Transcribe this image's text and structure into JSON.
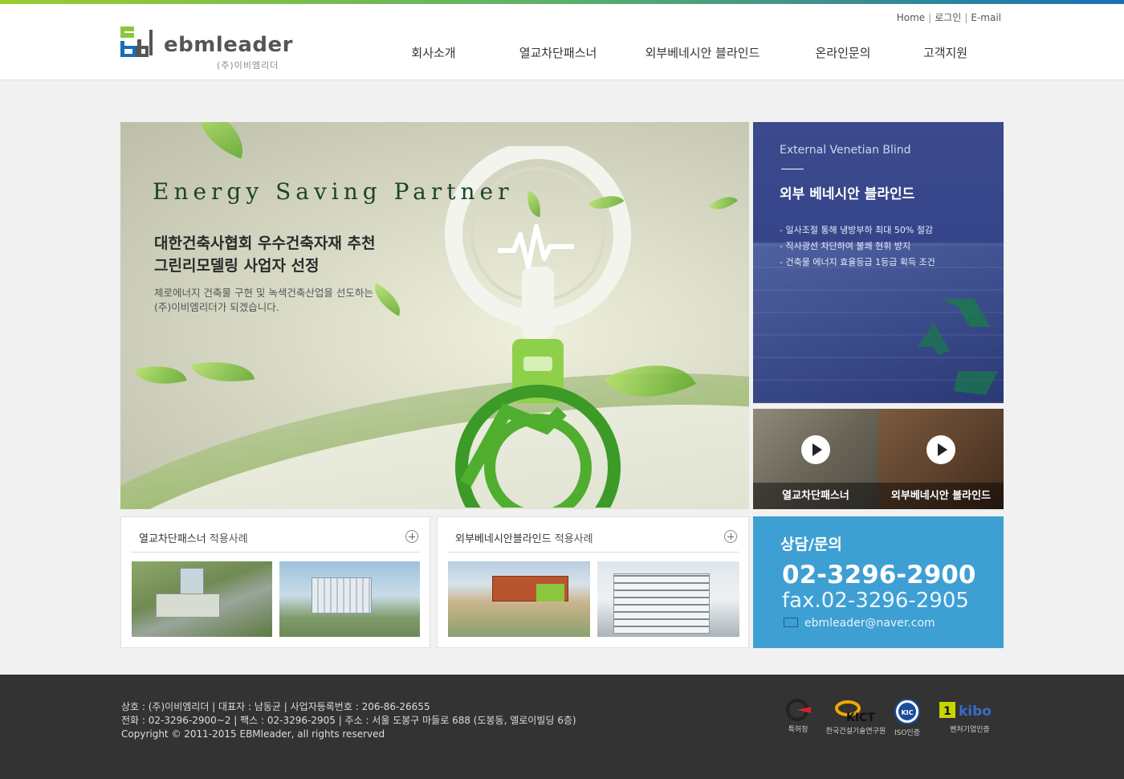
{
  "util_links": [
    "Home",
    "로그인",
    "E-mail"
  ],
  "logo": {
    "name": "ebmleader",
    "sub": "(주)이비엠리더"
  },
  "nav": [
    "회사소개",
    "열교차단패스너",
    "외부베네시안 블라인드",
    "온라인문의",
    "고객지원"
  ],
  "hero": {
    "title": "Energy Saving Partner",
    "headline_1": "대한건축사협회 우수건축자재 추천",
    "headline_2": "그린리모델링 사업자 선정",
    "desc_1": "제로에너지 건축물 구현 및 녹색건축산업을 선도하는",
    "desc_2": "(주)이비엠리더가 되겠습니다."
  },
  "evb": {
    "en": "External Venetian Blind",
    "ko": "외부 베네시안 블라인드",
    "points": [
      "- 일사조절 통해 냉방부하 최대 50% 절감",
      "- 직사광선 차단하여 불쾌 현휘 방지",
      "- 건축물 에너지 효율등급 1등급 획득 조건"
    ]
  },
  "videos": [
    {
      "label": "열교차단패스너"
    },
    {
      "label": "외부베네시안 블라인드"
    }
  ],
  "cases": [
    {
      "title": "열교차단패스너",
      "suffix": " 적용사례"
    },
    {
      "title": "외부베네시안블라인드",
      "suffix": " 적용사례"
    }
  ],
  "contact": {
    "title": "상담/문의",
    "tel": "02-3296-2900",
    "fax": "fax.02-3296-2905",
    "email": "ebmleader@naver.com"
  },
  "footer": {
    "line1": "상호 : (주)이비엠리더  |  대표자 : 남동균  |  사업자등록번호 : 206-86-26655",
    "line2": "전화 : 02-3296-2900~2  |  팩스 : 02-3296-2905  |  주소 : 서울 도봉구 마들로 688 (도봉동, 엘로이빌딩 6층)",
    "line3": "Copyright © 2011-2015 EBMleader, all rights reserved"
  },
  "certs": [
    {
      "label": "특허청"
    },
    {
      "label": "한국건설기술연구원",
      "logo_text": "KICT"
    },
    {
      "label": "ISO인증",
      "logo_text": "KIC"
    },
    {
      "label": "벤처기업인증",
      "logo_text": "kibo"
    }
  ],
  "colors": {
    "accent": "#3e9fd3",
    "evb_bg": "#34438a",
    "footer_bg": "#333333"
  }
}
